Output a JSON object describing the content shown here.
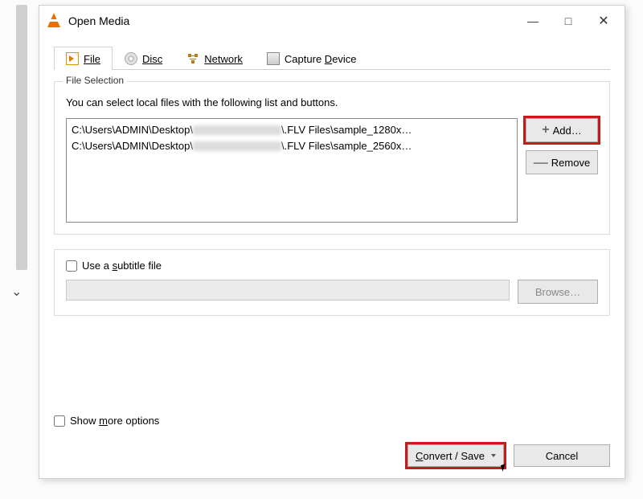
{
  "window": {
    "title": "Open Media",
    "minimize": "—",
    "maximize": "□",
    "close": "✕"
  },
  "tabs": {
    "file": "File",
    "disc": "Disc",
    "network": "Network",
    "capture": "Capture Device"
  },
  "file_selection": {
    "legend": "File Selection",
    "hint": "You can select local files with the following list and buttons.",
    "items": [
      {
        "pre": "C:\\Users\\ADMIN\\Desktop\\",
        "post": "\\.FLV Files\\sample_1280x…"
      },
      {
        "pre": "C:\\Users\\ADMIN\\Desktop\\",
        "post": "\\.FLV Files\\sample_2560x…"
      }
    ],
    "add_label": "Add…",
    "remove_label": "Remove"
  },
  "subtitle": {
    "checkbox_label": "Use a subtitle file",
    "browse_label": "Browse…"
  },
  "footer": {
    "show_more": "Show more options",
    "convert_label": "Convert / Save",
    "cancel_label": "Cancel"
  }
}
